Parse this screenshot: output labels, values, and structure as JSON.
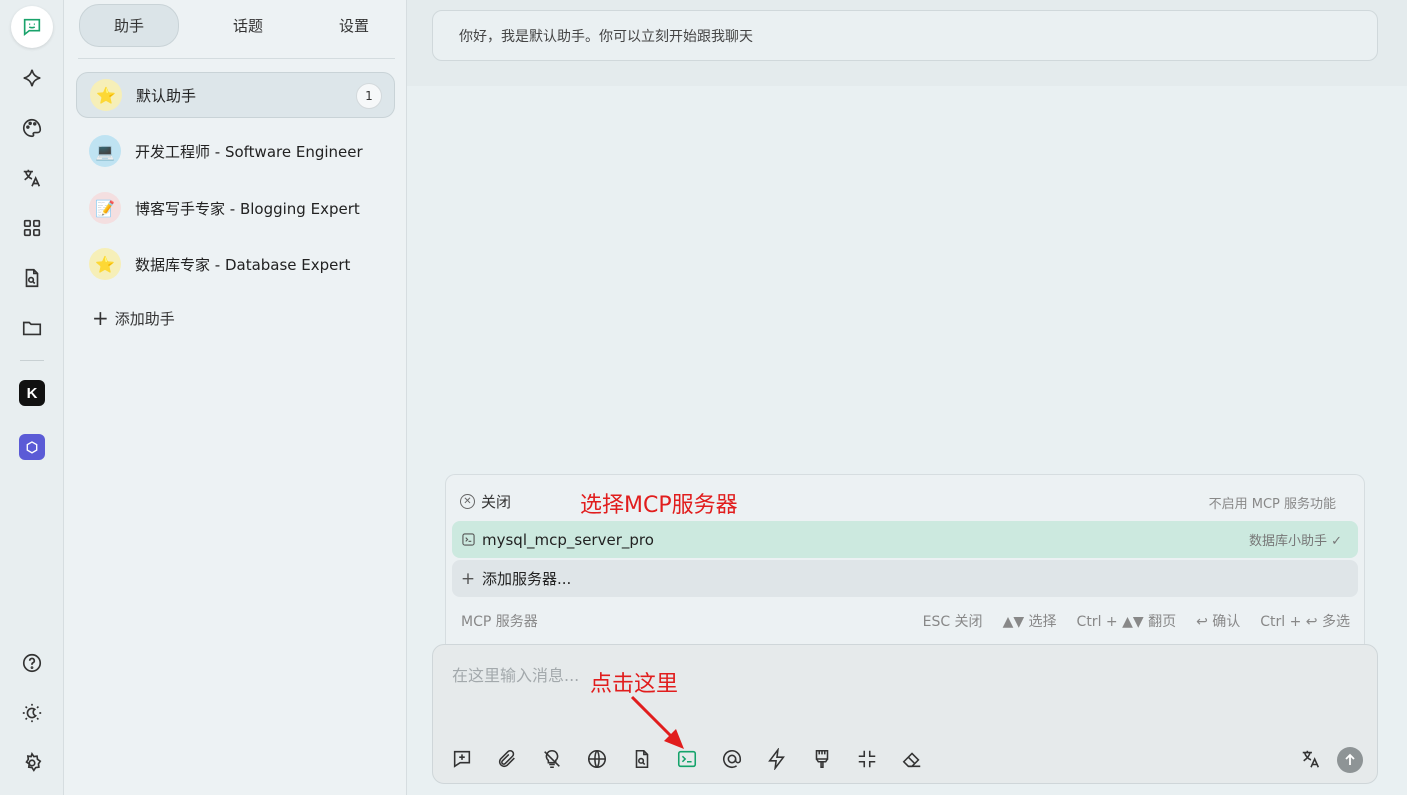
{
  "colors": {
    "accent": "#14a36a",
    "annotation": "#e11d1d",
    "selected_row": "#cce9df"
  },
  "rail": {
    "icons": [
      "chat-icon",
      "sparkle-icon",
      "palette-icon",
      "translate-icon",
      "apps-grid-icon",
      "file-search-icon",
      "folder-icon"
    ],
    "mini_apps": [
      {
        "letter": "K",
        "name": "mini-app-k"
      },
      {
        "letter": "⬡",
        "name": "mini-app-hex"
      }
    ],
    "bottom_icons": [
      "help-icon",
      "theme-icon",
      "settings-icon"
    ]
  },
  "tabs": {
    "assistants": "助手",
    "topics": "话题",
    "settings": "设置"
  },
  "assistants": [
    {
      "name": "默认助手",
      "emoji": "⭐",
      "count": "1"
    },
    {
      "name": "开发工程师 - Software Engineer",
      "emoji": "💻"
    },
    {
      "name": "博客写手专家 - Blogging Expert",
      "emoji": "📝"
    },
    {
      "name": "数据库专家 - Database Expert",
      "emoji": "⭐"
    }
  ],
  "add_assistant": "添加助手",
  "welcome_message": "你好，我是默认助手。你可以立刻开始跟我聊天",
  "mcp_popup": {
    "close_label": "关闭",
    "annotation_title": "选择MCP服务器",
    "disable_text": "不启用 MCP 服务功能",
    "server_name": "mysql_mcp_server_pro",
    "server_tag": "数据库小助手 ✓",
    "add_server": "添加服务器...",
    "footer_label": "MCP 服务器",
    "hints": [
      "ESC 关闭",
      "▲▼ 选择",
      "Ctrl + ▲▼ 翻页",
      "↩ 确认",
      "Ctrl + ↩ 多选"
    ]
  },
  "input": {
    "placeholder": "在这里输入消息...",
    "annotation": "点击这里",
    "tools": [
      "new-topic-icon",
      "attachment-icon",
      "no-idea-icon",
      "web-search-icon",
      "knowledge-icon",
      "mcp-terminal-icon",
      "mention-icon",
      "quick-phrase-icon",
      "clear-context-icon",
      "collapse-icon",
      "eraser-icon"
    ],
    "right_tools": [
      "translate-icon",
      "send-icon"
    ]
  }
}
